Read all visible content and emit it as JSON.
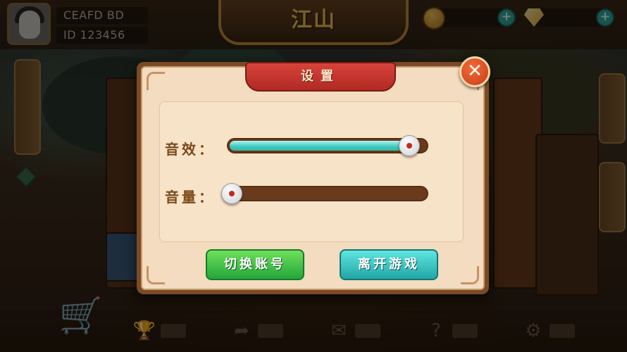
{
  "header": {
    "user_name": "CEAFD BD",
    "user_id": "ID 123456",
    "game_title": "江山"
  },
  "side_tabs": {
    "left": "",
    "right_top": "",
    "right_bottom": ""
  },
  "dialog": {
    "title": "设置",
    "close_icon": "close-icon",
    "rows": [
      {
        "label": "音效：",
        "value": 0.96
      },
      {
        "label": "音量：",
        "value": 0.0
      }
    ],
    "buttons": {
      "switch_account": "切换账号",
      "leave_game": "离开游戏"
    }
  },
  "colors": {
    "ribbon": "#c8352e",
    "slider_fill": "#3cc8c0",
    "green_button": "#2fb640",
    "teal_button": "#2cb8b8",
    "close_button": "#e0542a"
  }
}
